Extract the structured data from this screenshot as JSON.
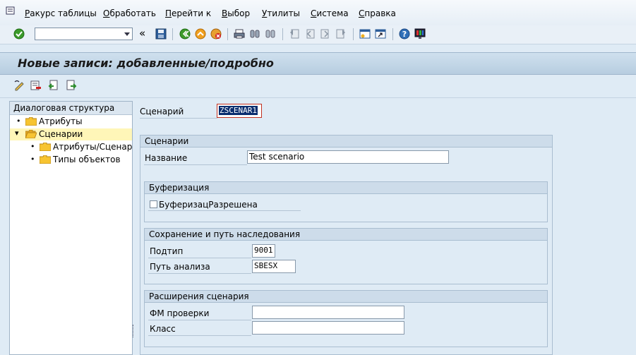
{
  "menu": {
    "items": [
      "Ракурс таблицы",
      "Обработать",
      "Перейти к",
      "Выбор",
      "Утилиты",
      "Система",
      "Справка"
    ],
    "underlined": [
      "Р",
      "О",
      "П",
      "В",
      "У",
      "С",
      "С"
    ]
  },
  "toolbar": {
    "command_value": "",
    "icons": [
      "check-icon",
      "back-arrows-icon",
      "save-icon",
      "back-icon",
      "exit-icon",
      "cancel-icon",
      "print-icon",
      "find-icon",
      "find-next-icon",
      "first-page-icon",
      "prev-page-icon",
      "next-page-icon",
      "last-page-icon",
      "new-session-icon",
      "shortcut-icon",
      "help-icon",
      "layout-icon"
    ]
  },
  "title": "Новые записи: добавленные/подробно",
  "app_toolbar": {
    "icons": [
      "change-display-icon",
      "delete-icon",
      "undo-icon",
      "copy-icon"
    ]
  },
  "tree": {
    "header": "Диалоговая структура",
    "nodes": [
      {
        "label": "Атрибуты",
        "level": 0,
        "expanded": false,
        "selected": false
      },
      {
        "label": "Сценарии",
        "level": 0,
        "expanded": true,
        "selected": true
      },
      {
        "label": "Атрибуты/Сценарий",
        "level": 1,
        "expanded": false,
        "selected": false
      },
      {
        "label": "Типы объектов",
        "level": 1,
        "expanded": false,
        "selected": false
      }
    ]
  },
  "form": {
    "scenario_label": "Сценарий",
    "scenario_value": "ZSCENAR1",
    "group_scenarios": {
      "title": "Сценарии",
      "name_label": "Название",
      "name_value": "Test scenario"
    },
    "group_buffering": {
      "title": "Буферизация",
      "checkbox_label": "БуферизацРазрешена",
      "checked": false
    },
    "group_save": {
      "title": "Сохранение и путь наследования",
      "subtype_label": "Подтип",
      "subtype_value": "9001",
      "path_label": "Путь анализа",
      "path_value": "SBESX"
    },
    "group_ext": {
      "title": "Расширения сценария",
      "fm_label": "ФМ проверки",
      "fm_value": "",
      "class_label": "Класс",
      "class_value": ""
    }
  }
}
